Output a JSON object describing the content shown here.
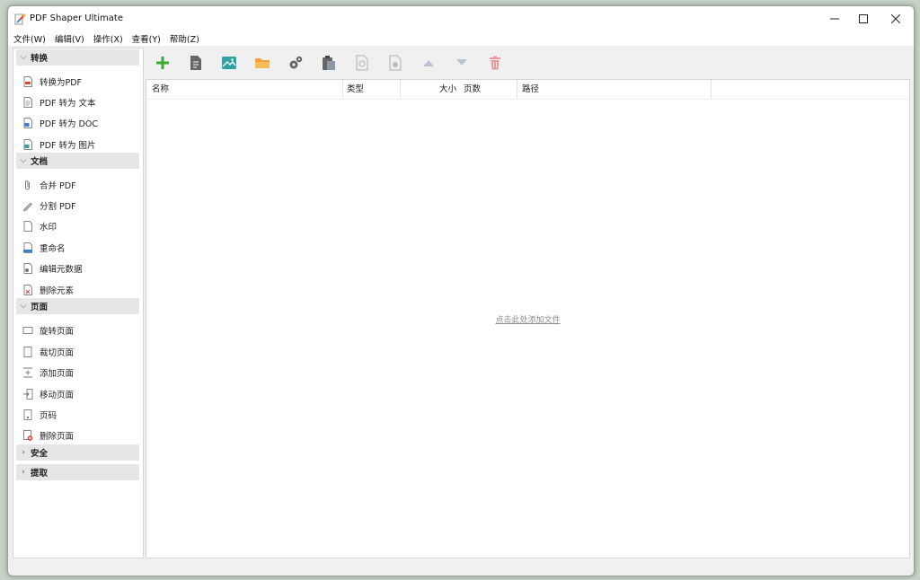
{
  "window": {
    "title": "PDF Shaper Ultimate",
    "controls": [
      "minimize-icon",
      "maximize-icon",
      "close-icon"
    ]
  },
  "menu": [
    "文件(W)",
    "编辑(V)",
    "操作(X)",
    "查看(Y)",
    "帮助(Z)"
  ],
  "sidebar": {
    "groups": [
      {
        "label": "转换",
        "expanded": true,
        "items": [
          {
            "label": "转换为PDF",
            "icon": "pdf-icon"
          },
          {
            "label": "PDF 转为 文本",
            "icon": "text-doc-icon"
          },
          {
            "label": "PDF 转为 DOC",
            "icon": "word-doc-icon"
          },
          {
            "label": "PDF 转为 图片",
            "icon": "image-doc-icon"
          }
        ]
      },
      {
        "label": "文档",
        "expanded": true,
        "items": [
          {
            "label": "合并 PDF",
            "icon": "paperclip-icon"
          },
          {
            "label": "分割 PDF",
            "icon": "pen-split-icon"
          },
          {
            "label": "水印",
            "icon": "watermark-icon"
          },
          {
            "label": "重命名",
            "icon": "rename-icon"
          },
          {
            "label": "编辑元数据",
            "icon": "metadata-icon"
          },
          {
            "label": "删除元素",
            "icon": "remove-elements-icon"
          }
        ]
      },
      {
        "label": "页面",
        "expanded": true,
        "items": [
          {
            "label": "旋转页面",
            "icon": "rotate-page-icon"
          },
          {
            "label": "裁切页面",
            "icon": "crop-page-icon"
          },
          {
            "label": "添加页面",
            "icon": "add-page-icon"
          },
          {
            "label": "移动页面",
            "icon": "move-page-icon"
          },
          {
            "label": "页码",
            "icon": "page-number-icon"
          },
          {
            "label": "删除页面",
            "icon": "delete-page-icon"
          }
        ]
      },
      {
        "label": "安全",
        "expanded": false,
        "items": []
      },
      {
        "label": "提取",
        "expanded": false,
        "items": []
      }
    ]
  },
  "toolbar": {
    "buttons": [
      {
        "icon": "add-icon",
        "enabled": true
      },
      {
        "icon": "document-icon",
        "enabled": true
      },
      {
        "icon": "image-icon",
        "enabled": true
      },
      {
        "icon": "folder-icon",
        "enabled": true
      },
      {
        "icon": "settings-icon",
        "enabled": true
      },
      {
        "icon": "clipboard-icon",
        "enabled": true
      },
      {
        "icon": "preview-icon",
        "enabled": false
      },
      {
        "icon": "info-icon",
        "enabled": false
      },
      {
        "icon": "move-up-icon",
        "enabled": false
      },
      {
        "icon": "move-down-icon",
        "enabled": false
      },
      {
        "icon": "delete-icon",
        "enabled": false
      }
    ]
  },
  "file_list": {
    "columns": [
      "名称",
      "类型",
      "大小",
      "页数",
      "路径"
    ],
    "rows": [],
    "empty_link": "点击此处添加文件"
  },
  "colors": {
    "accent_green": "#3aaa35",
    "folder_orange": "#f2a33a",
    "image_teal": "#2fa3a3",
    "delete_red": "#e07070"
  }
}
